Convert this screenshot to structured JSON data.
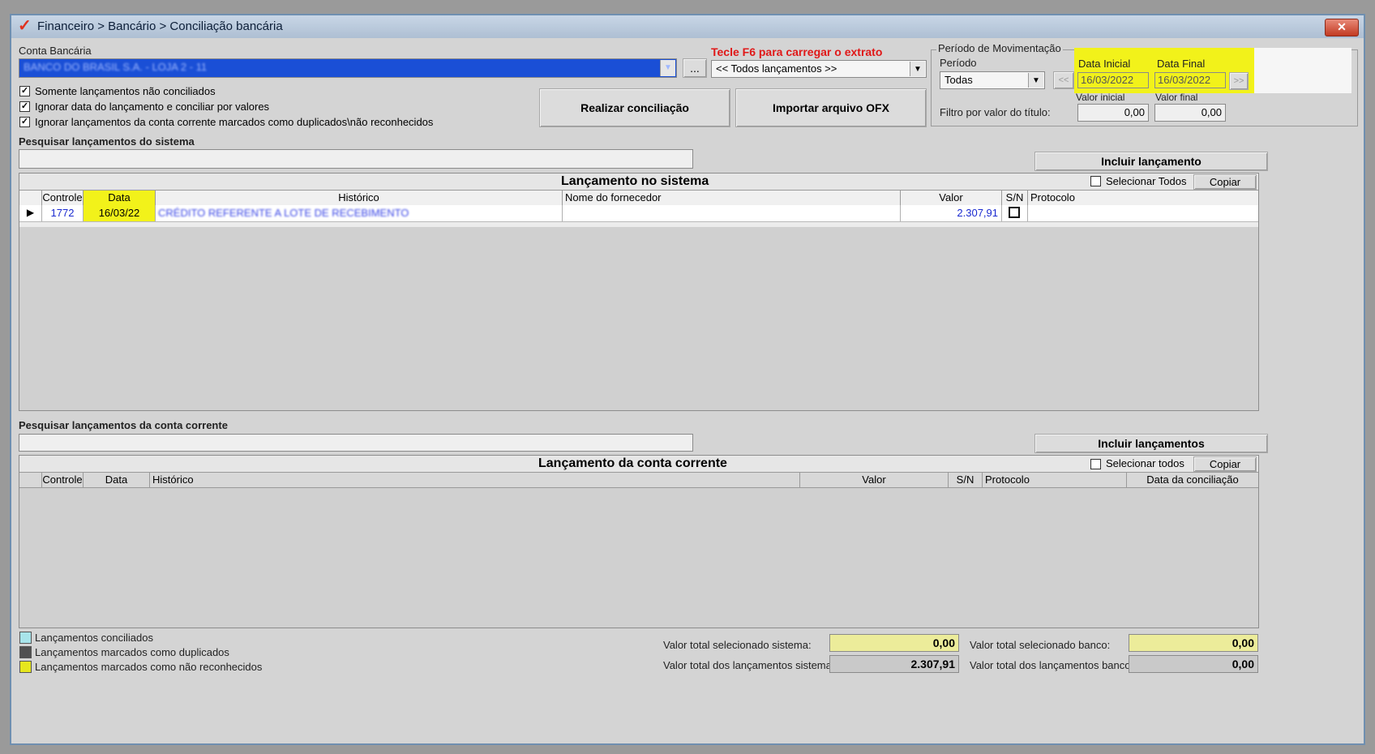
{
  "window": {
    "title": "Financeiro > Bancário > Conciliação bancária",
    "close": "✕"
  },
  "conta": {
    "label": "Conta Bancária",
    "value": "BANCO DO BRASIL S.A. - LOJA 2 - 11",
    "ellipsis": "..."
  },
  "extrato": {
    "hint": "Tecle F6 para carregar o extrato",
    "value": "<< Todos lançamentos >>"
  },
  "periodo": {
    "group": "Período de Movimentação",
    "periodo_label": "Período",
    "periodo_value": "Todas",
    "data_inicial_label": "Data Inicial",
    "data_inicial": "16/03/2022",
    "data_final_label": "Data Final",
    "data_final": "16/03/2022",
    "prev": "<<",
    "next": ">>",
    "filtro_label": "Filtro por valor do título:",
    "valor_inicial_label": "Valor inicial",
    "valor_inicial": "0,00",
    "valor_final_label": "Valor final",
    "valor_final": "0,00"
  },
  "options": [
    {
      "label": "Somente lançamentos não conciliados",
      "checked": true
    },
    {
      "label": "Ignorar data do lançamento e conciliar por valores",
      "checked": true
    },
    {
      "label": "Ignorar lançamentos da conta corrente marcados como duplicados\\não reconhecidos",
      "checked": true
    }
  ],
  "buttons": {
    "realizar": "Realizar conciliação",
    "importar": "Importar arquivo OFX",
    "incluir_lancamento": "Incluir lançamento",
    "incluir_lancamentos": "Incluir lançamentos"
  },
  "sistema": {
    "search_label": "Pesquisar lançamentos do sistema",
    "title": "Lançamento no sistema",
    "select_all": "Selecionar Todos",
    "copy": "Copiar",
    "columns": [
      "Controle",
      "Data",
      "Histórico",
      "Nome do fornecedor",
      "Valor",
      "S/N",
      "Protocolo"
    ],
    "rows": [
      {
        "controle": "1772",
        "data": "16/03/22",
        "historico": "CRÉDITO REFERENTE A LOTE DE RECEBIMENTO",
        "fornecedor": "",
        "valor": "2.307,91",
        "sn": "",
        "protocolo": ""
      }
    ]
  },
  "conta_corrente": {
    "search_label": "Pesquisar lançamentos da conta corrente",
    "title": "Lançamento da conta corrente",
    "select_all": "Selecionar todos",
    "copy": "Copiar",
    "columns": [
      "Controle",
      "Data",
      "Histórico",
      "Valor",
      "S/N",
      "Protocolo",
      "Data da conciliação"
    ]
  },
  "legend": [
    {
      "label": "Lançamentos conciliados",
      "color": "#a8e4ea"
    },
    {
      "label": "Lançamentos marcados como duplicados",
      "color": "#505050"
    },
    {
      "label": "Lançamentos marcados como não reconhecidos",
      "color": "#e6e61e"
    }
  ],
  "totals": {
    "sel_sistema_label": "Valor total selecionado sistema:",
    "sel_sistema": "0,00",
    "tot_sistema_label": "Valor total dos lançamentos sistema:",
    "tot_sistema": "2.307,91",
    "sel_banco_label": "Valor total selecionado banco:",
    "sel_banco": "0,00",
    "tot_banco_label": "Valor total dos lançamentos banco:",
    "tot_banco": "0,00"
  }
}
